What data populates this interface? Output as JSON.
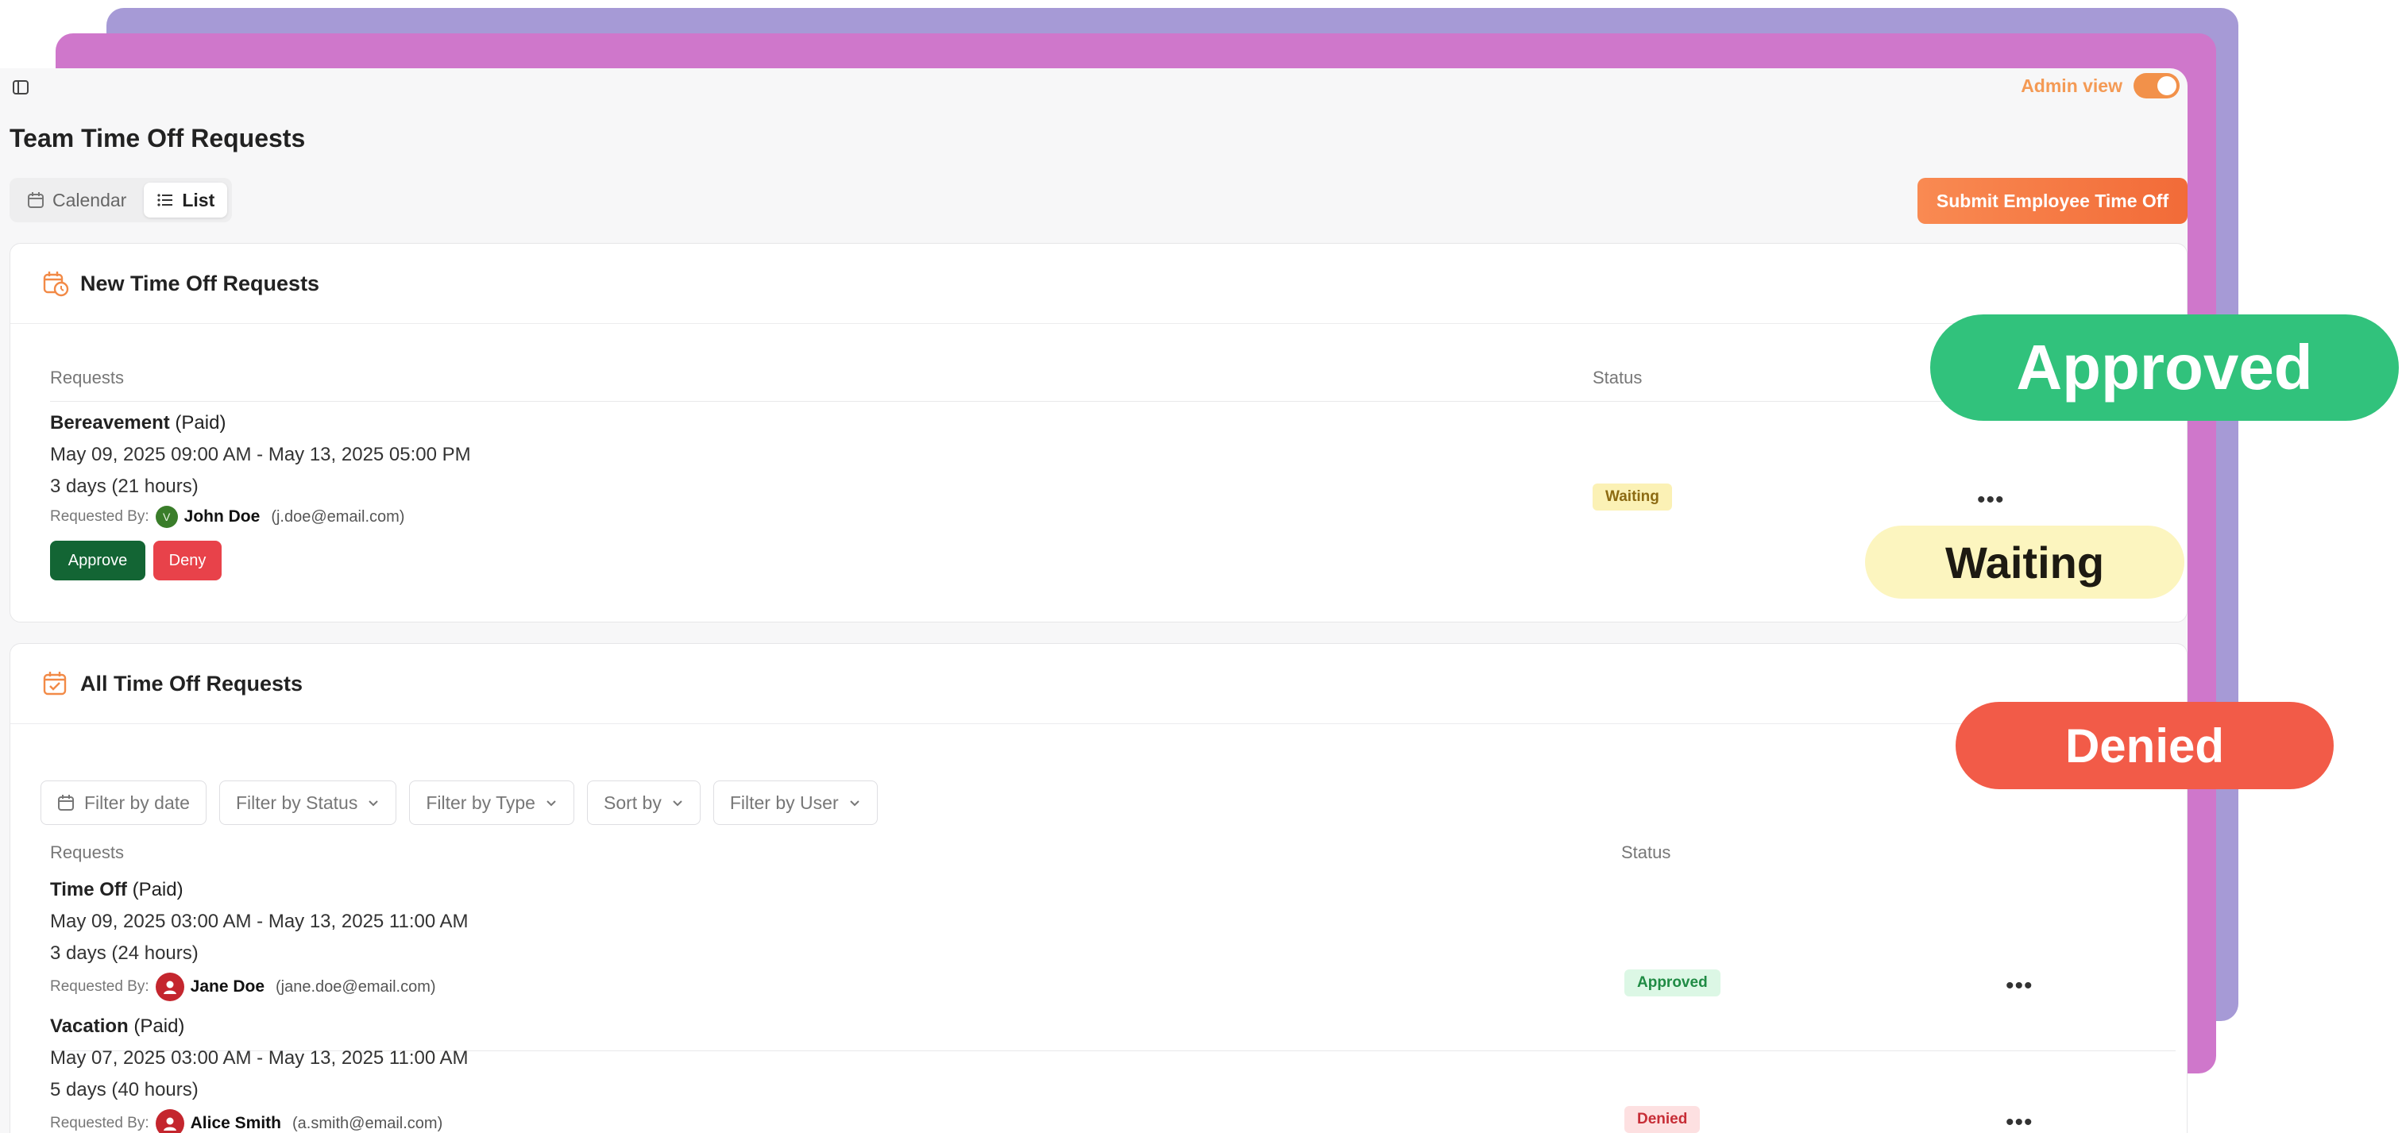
{
  "header": {
    "admin_label": "Admin view",
    "admin_on": true,
    "title": "Team Time Off Requests",
    "views": [
      "Calendar",
      "List"
    ],
    "active_view": "List",
    "submit_label": "Submit Employee Time Off"
  },
  "new_requests": {
    "title": "New Time Off Requests",
    "col_requests": "Requests",
    "col_status": "Status",
    "items": [
      {
        "type": "Bereavement",
        "pay": "(Paid)",
        "range": "May 09, 2025 09:00 AM - May 13, 2025 05:00 PM",
        "duration": "3 days (21 hours)",
        "requested_by_label": "Requested By:",
        "avatar_initial": "V",
        "name": "John Doe",
        "email": "(j.doe@email.com)",
        "status": "Waiting",
        "approve_label": "Approve",
        "deny_label": "Deny"
      }
    ]
  },
  "all_requests": {
    "title": "All Time Off Requests",
    "filters": [
      "Filter by date",
      "Filter by Status",
      "Filter by Type",
      "Sort by",
      "Filter by User"
    ],
    "col_requests": "Requests",
    "col_status": "Status",
    "items": [
      {
        "type": "Time Off",
        "pay": "(Paid)",
        "range": "May 09, 2025 03:00 AM - May 13, 2025 11:00 AM",
        "duration": "3 days (24 hours)",
        "requested_by_label": "Requested By:",
        "name": "Jane Doe",
        "email": "(jane.doe@email.com)",
        "status": "Approved"
      },
      {
        "type": "Vacation",
        "pay": "(Paid)",
        "range": "May 07, 2025 03:00 AM - May 13, 2025 11:00 AM",
        "duration": "5 days (40 hours)",
        "requested_by_label": "Requested By:",
        "name": "Alice Smith",
        "email": "(a.smith@email.com)",
        "status": "Denied"
      }
    ]
  },
  "overlays": {
    "approved": "Approved",
    "waiting": "Waiting",
    "denied": "Denied"
  },
  "colors": {
    "accent_orange": "#f26b38",
    "approve_green": "#136534",
    "deny_red": "#e8424a",
    "stack_purple": "#a69ad6",
    "stack_magenta": "#cf77cb"
  }
}
